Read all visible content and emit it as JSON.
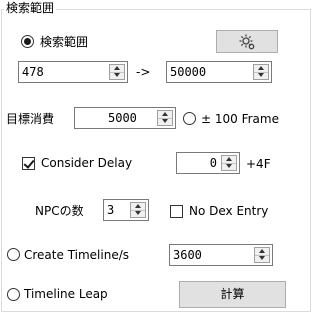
{
  "group": {
    "title": "検索範囲"
  },
  "search_range": {
    "radio_label": "検索範囲",
    "radio_checked": true,
    "start_value": "478",
    "arrow": "->",
    "end_value": "50000",
    "gear_icon": "gear-icon"
  },
  "target_consumption": {
    "label": "目標消費",
    "value": "5000",
    "frame_radio_label": "± 100 Frame",
    "frame_radio_checked": false
  },
  "consider_delay": {
    "label": "Consider Delay",
    "checked": true,
    "value": "0",
    "suffix": "+4F"
  },
  "npc": {
    "label": "NPCの数",
    "value": "3",
    "no_dex_label": "No Dex Entry",
    "no_dex_checked": false
  },
  "create_timeline": {
    "label": "Create Timeline/s",
    "checked": false,
    "value": "3600"
  },
  "timeline_leap": {
    "label": "Timeline Leap",
    "checked": false
  },
  "calculate_button": {
    "label": "計算"
  }
}
